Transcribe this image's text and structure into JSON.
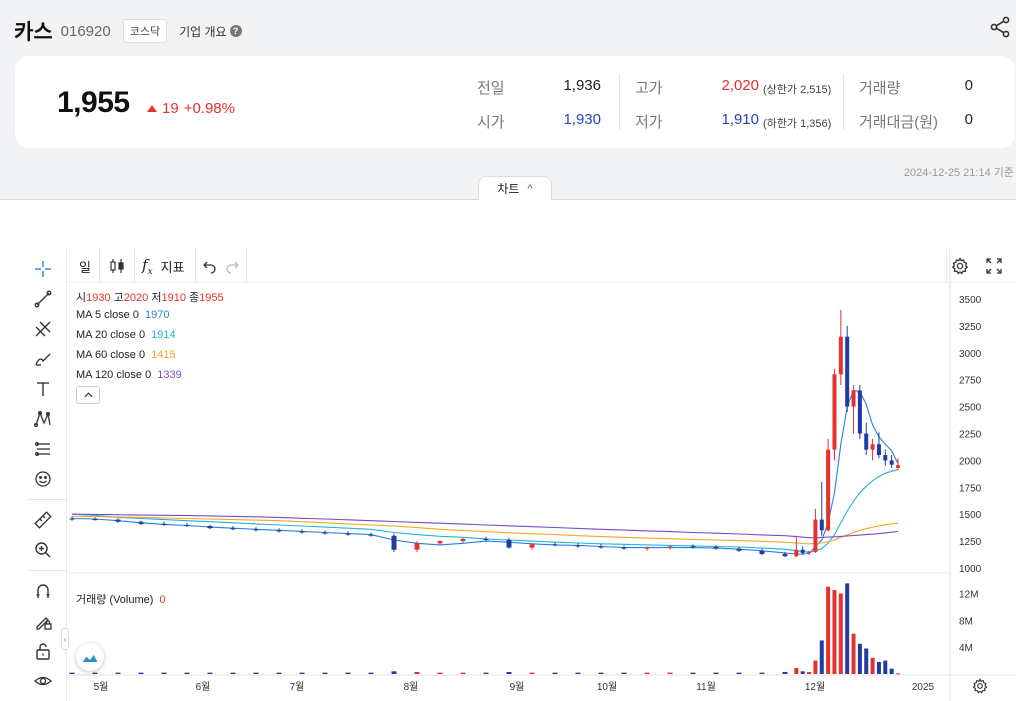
{
  "header": {
    "name": "카스",
    "code": "016920",
    "market": "코스닥",
    "overview_label": "기업 개요",
    "help_icon": "question-icon",
    "share_icon": "share-icon"
  },
  "quote": {
    "price": "1,955",
    "change": "19",
    "change_pct": "+0.98%",
    "prev_label": "전일",
    "prev_value": "1,936",
    "open_label": "시가",
    "open_value": "1,930",
    "high_label": "고가",
    "high_value": "2,020",
    "upper_limit": "(상한가 2,515)",
    "low_label": "저가",
    "low_value": "1,910",
    "lower_limit": "(하한가 1,356)",
    "volume_label": "거래량",
    "volume_value": "0",
    "amount_label": "거래대금(원)",
    "amount_value": "0",
    "timestamp": "2024-12-25 21:14 기준"
  },
  "chart_tab": {
    "label": "차트",
    "chevron": "^"
  },
  "toolbar": {
    "period_label": "일",
    "indicator_label": "지표",
    "fx_label": "f",
    "fx_sub": "x"
  },
  "legend": {
    "o_label": "시",
    "o_value": "1930",
    "h_label": "고",
    "h_value": "2020",
    "l_label": "저",
    "l_value": "1910",
    "c_label": "종",
    "c_value": "1955",
    "ma": [
      {
        "label": "MA 5 close 0",
        "value": "1970",
        "color": "#2a7de1"
      },
      {
        "label": "MA 20 close 0",
        "value": "1914",
        "color": "#1fb5d4"
      },
      {
        "label": "MA 60 close 0",
        "value": "1415",
        "color": "#f5a623"
      },
      {
        "label": "MA 120 close 0",
        "value": "1339",
        "color": "#7a4cc2"
      }
    ],
    "volume_label": "거래량 (Volume)",
    "volume_value": "0"
  },
  "colors": {
    "up": "#e5322d",
    "down": "#1f3c9e",
    "accent_blue": "#2c3fb5"
  },
  "chart_data": {
    "type": "candlestick",
    "x_ticks": [
      "5월",
      "6월",
      "7월",
      "8월",
      "9월",
      "10월",
      "11월",
      "12월",
      "2025"
    ],
    "y_ticks": [
      "3500",
      "3250",
      "3000",
      "2750",
      "2500",
      "2250",
      "2000",
      "1750",
      "1500",
      "1250",
      "1000"
    ],
    "y_range": [
      1000,
      3500
    ],
    "volume_ticks": [
      "12M",
      "8M",
      "4M"
    ],
    "volume_range": [
      0,
      14
    ],
    "volume_unit": "M",
    "candles_ohlc": [
      [
        1460,
        1480,
        1440,
        1455
      ],
      [
        1455,
        1470,
        1440,
        1450
      ],
      [
        1450,
        1460,
        1420,
        1430
      ],
      [
        1430,
        1440,
        1400,
        1410
      ],
      [
        1410,
        1430,
        1390,
        1400
      ],
      [
        1400,
        1420,
        1380,
        1390
      ],
      [
        1390,
        1400,
        1360,
        1370
      ],
      [
        1370,
        1390,
        1350,
        1360
      ],
      [
        1360,
        1380,
        1340,
        1350
      ],
      [
        1350,
        1370,
        1330,
        1340
      ],
      [
        1340,
        1360,
        1320,
        1330
      ],
      [
        1330,
        1350,
        1310,
        1320
      ],
      [
        1320,
        1340,
        1300,
        1310
      ],
      [
        1310,
        1330,
        1290,
        1300
      ],
      [
        1300,
        1320,
        1150,
        1170
      ],
      [
        1170,
        1250,
        1150,
        1230
      ],
      [
        1230,
        1260,
        1210,
        1250
      ],
      [
        1250,
        1280,
        1230,
        1270
      ],
      [
        1270,
        1290,
        1250,
        1260
      ],
      [
        1260,
        1280,
        1180,
        1190
      ],
      [
        1190,
        1230,
        1170,
        1220
      ],
      [
        1220,
        1240,
        1200,
        1210
      ],
      [
        1210,
        1230,
        1190,
        1200
      ],
      [
        1200,
        1220,
        1180,
        1190
      ],
      [
        1190,
        1210,
        1170,
        1180
      ],
      [
        1180,
        1200,
        1160,
        1190
      ],
      [
        1190,
        1210,
        1170,
        1200
      ],
      [
        1200,
        1220,
        1180,
        1195
      ],
      [
        1195,
        1210,
        1170,
        1180
      ],
      [
        1180,
        1200,
        1150,
        1160
      ],
      [
        1160,
        1180,
        1120,
        1130
      ],
      [
        1130,
        1150,
        1100,
        1110
      ],
      [
        1110,
        1300,
        1100,
        1170
      ],
      [
        1170,
        1200,
        1120,
        1140
      ],
      [
        1140,
        1160,
        1120,
        1150
      ],
      [
        1150,
        1550,
        1140,
        1450
      ],
      [
        1450,
        1800,
        1300,
        1350
      ],
      [
        1350,
        2200,
        1340,
        2100
      ],
      [
        2100,
        2850,
        2000,
        2800
      ],
      [
        2800,
        3400,
        2700,
        3150
      ],
      [
        3150,
        3250,
        2450,
        2500
      ],
      [
        2500,
        2700,
        2250,
        2650
      ],
      [
        2650,
        2700,
        2200,
        2250
      ],
      [
        2250,
        2350,
        2050,
        2100
      ],
      [
        2100,
        2200,
        2000,
        2150
      ],
      [
        2150,
        2260,
        2020,
        2050
      ],
      [
        2050,
        2100,
        1950,
        2000
      ],
      [
        2000,
        2050,
        1930,
        1960
      ],
      [
        1930,
        2020,
        1910,
        1955
      ]
    ],
    "volumes_m": [
      0.2,
      0.2,
      0.2,
      0.2,
      0.2,
      0.2,
      0.2,
      0.2,
      0.2,
      0.2,
      0.2,
      0.2,
      0.2,
      0.2,
      0.4,
      0.3,
      0.2,
      0.2,
      0.2,
      0.3,
      0.2,
      0.2,
      0.2,
      0.2,
      0.2,
      0.2,
      0.2,
      0.2,
      0.2,
      0.2,
      0.2,
      0.3,
      0.9,
      0.4,
      0.3,
      2.0,
      5.0,
      13.0,
      12.5,
      12.0,
      13.5,
      6.0,
      4.5,
      3.8,
      2.4,
      1.8,
      2.0,
      0.8,
      0.1
    ],
    "ma_series": [
      {
        "name": "MA 5 close 0",
        "color": "#2a7de1",
        "values": [
          1460,
          1455,
          1440,
          1420,
          1405,
          1395,
          1380,
          1370,
          1360,
          1350,
          1340,
          1330,
          1320,
          1310,
          1260,
          1230,
          1215,
          1230,
          1250,
          1240,
          1225,
          1215,
          1210,
          1200,
          1190,
          1190,
          1190,
          1190,
          1185,
          1175,
          1160,
          1140,
          1130,
          1130,
          1135,
          1200,
          1260,
          1420,
          1700,
          2150,
          2500,
          2650,
          2640,
          2520,
          2330,
          2220,
          2150,
          2090,
          1970
        ]
      },
      {
        "name": "MA 20 close 0",
        "color": "#1fb5d4",
        "values": [
          1500,
          1490,
          1470,
          1460,
          1450,
          1440,
          1430,
          1420,
          1410,
          1400,
          1390,
          1380,
          1370,
          1360,
          1330,
          1310,
          1295,
          1285,
          1270,
          1260,
          1250,
          1240,
          1232,
          1225,
          1220,
          1215,
          1210,
          1205,
          1200,
          1195,
          1185,
          1175,
          1160,
          1152,
          1148,
          1160,
          1180,
          1230,
          1310,
          1420,
          1530,
          1620,
          1700,
          1760,
          1810,
          1850,
          1880,
          1900,
          1914
        ]
      },
      {
        "name": "MA 60 close 0",
        "color": "#f5a623",
        "values": [
          1480,
          1478,
          1475,
          1470,
          1465,
          1460,
          1455,
          1450,
          1445,
          1440,
          1430,
          1420,
          1410,
          1400,
          1390,
          1375,
          1360,
          1348,
          1338,
          1328,
          1318,
          1310,
          1300,
          1292,
          1285,
          1278,
          1272,
          1266,
          1260,
          1255,
          1248,
          1240,
          1232,
          1228,
          1225,
          1228,
          1232,
          1245,
          1262,
          1285,
          1308,
          1330,
          1350,
          1365,
          1380,
          1392,
          1402,
          1410,
          1415
        ]
      },
      {
        "name": "MA 120 close 0",
        "color": "#7a4cc2",
        "values": [
          1500,
          1498,
          1495,
          1492,
          1490,
          1487,
          1484,
          1480,
          1476,
          1470,
          1462,
          1455,
          1448,
          1440,
          1432,
          1424,
          1416,
          1408,
          1400,
          1392,
          1384,
          1376,
          1368,
          1360,
          1352,
          1345,
          1338,
          1330,
          1323,
          1316,
          1308,
          1300,
          1292,
          1286,
          1282,
          1282,
          1284,
          1287,
          1290,
          1294,
          1298,
          1302,
          1306,
          1310,
          1314,
          1320,
          1326,
          1333,
          1339
        ]
      }
    ]
  }
}
